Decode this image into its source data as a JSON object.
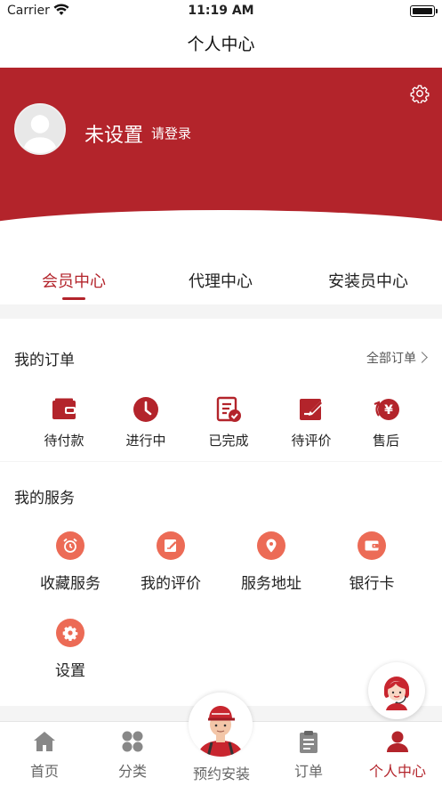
{
  "status_bar": {
    "carrier": "Carrier",
    "time": "11:19 AM"
  },
  "nav": {
    "title": "个人中心"
  },
  "profile": {
    "name": "未设置",
    "login_prompt": "请登录"
  },
  "tabs": [
    {
      "label": "会员中心",
      "active": true
    },
    {
      "label": "代理中心",
      "active": false
    },
    {
      "label": "安装员中心",
      "active": false
    }
  ],
  "orders": {
    "title": "我的订单",
    "view_all": "全部订单",
    "items": [
      {
        "label": "待付款",
        "icon": "wallet-icon"
      },
      {
        "label": "进行中",
        "icon": "clock-icon"
      },
      {
        "label": "已完成",
        "icon": "completed-list-icon"
      },
      {
        "label": "待评价",
        "icon": "edit-review-icon"
      },
      {
        "label": "售后",
        "icon": "refund-icon"
      }
    ]
  },
  "services": {
    "title": "我的服务",
    "items": [
      {
        "label": "收藏服务",
        "icon": "alarm-clock-icon"
      },
      {
        "label": "我的评价",
        "icon": "edit-icon"
      },
      {
        "label": "服务地址",
        "icon": "location-pin-icon"
      },
      {
        "label": "银行卡",
        "icon": "card-wallet-icon"
      },
      {
        "label": "设置",
        "icon": "gear-icon"
      }
    ]
  },
  "tabbar": {
    "items": [
      {
        "label": "首页",
        "icon": "home-icon",
        "active": false
      },
      {
        "label": "分类",
        "icon": "category-icon",
        "active": false
      },
      {
        "label": "预约安装",
        "icon": "installer-avatar-icon",
        "active": false
      },
      {
        "label": "订单",
        "icon": "clipboard-icon",
        "active": false
      },
      {
        "label": "个人中心",
        "icon": "person-icon",
        "active": true
      }
    ]
  },
  "colors": {
    "brand": "#b3242b",
    "service_icon": "#ec6b56",
    "inactive_icon": "#888888"
  }
}
